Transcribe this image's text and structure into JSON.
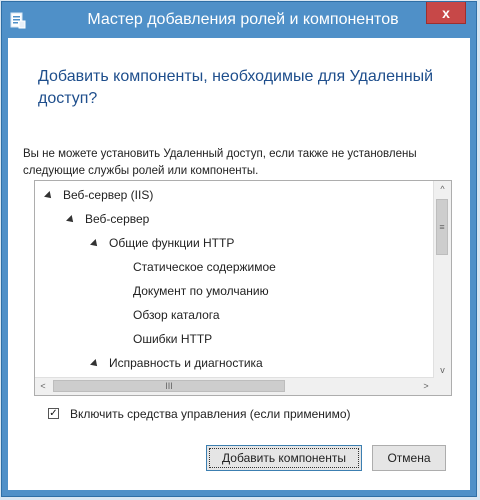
{
  "window": {
    "title": "Мастер добавления ролей и компонентов",
    "close_label": "x",
    "app_icon": "wizard-icon",
    "accent_color": "#4f90c8"
  },
  "dialog": {
    "heading": "Добавить компоненты, необходимые для Удаленный доступ?",
    "description": "Вы не можете установить Удаленный доступ, если также не установлены следующие службы ролей или компоненты."
  },
  "tree": {
    "items": [
      {
        "label": "Веб-сервер (IIS)",
        "expanded": true
      },
      {
        "label": "Веб-сервер",
        "expanded": true
      },
      {
        "label": "Общие функции HTTP",
        "expanded": true
      },
      {
        "label": "Статическое содержимое"
      },
      {
        "label": "Документ по умолчанию"
      },
      {
        "label": "Обзор каталога"
      },
      {
        "label": "Ошибки HTTP"
      },
      {
        "label": "Исправность и диагностика",
        "expanded": true
      }
    ],
    "vscroll": {
      "up": "^",
      "down": "v",
      "grip": "≡"
    },
    "hscroll": {
      "left": "<",
      "right": ">",
      "grip": "III"
    }
  },
  "checkbox": {
    "label": "Включить средства управления (если применимо)",
    "checked": true,
    "mark": "✓"
  },
  "buttons": {
    "add_label": "Добавить компоненты",
    "cancel_label": "Отмена"
  }
}
